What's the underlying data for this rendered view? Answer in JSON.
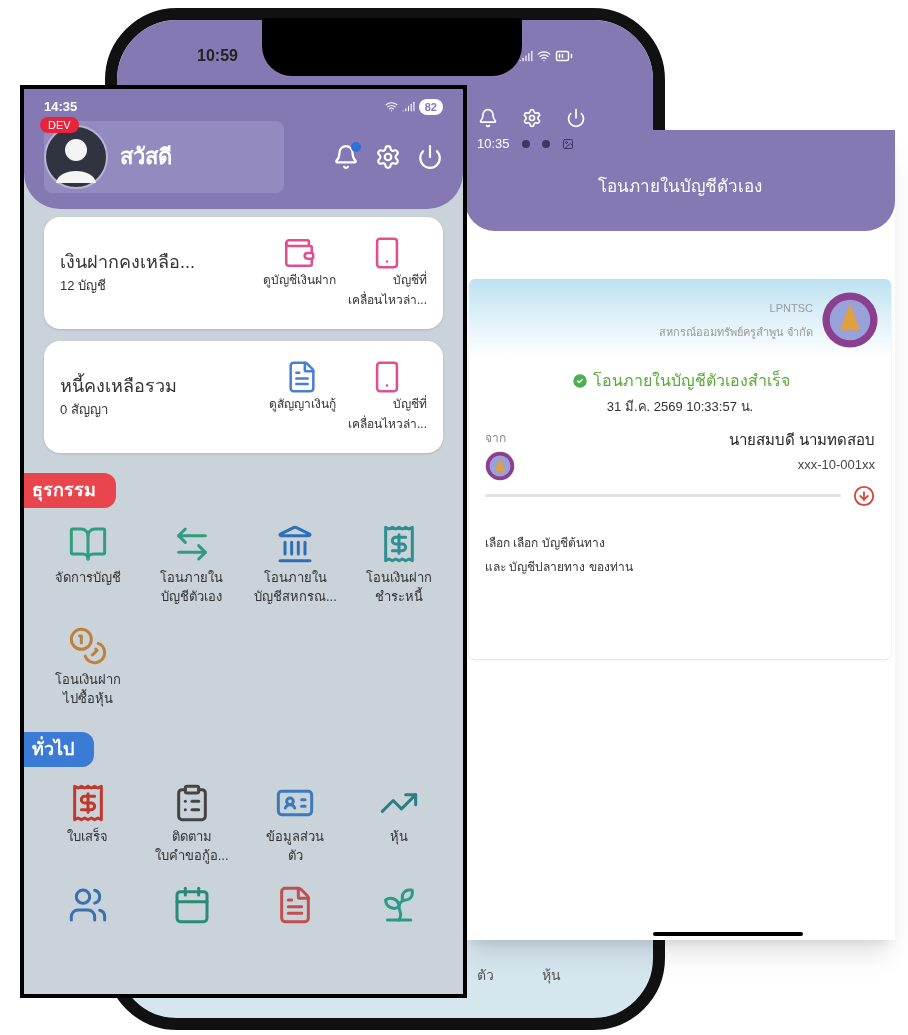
{
  "phone": {
    "time": "10:59",
    "bottom_labels": [
      "ตัว",
      "หุ้น"
    ]
  },
  "home_screen": {
    "status_time": "14:35",
    "battery": "82",
    "badge": "DEV",
    "greeting": "สวัสดี",
    "notification_dot": true,
    "summary_cards": [
      {
        "title": "เงินฝากคงเหลือ...",
        "subtitle": "12 บัญชี",
        "shortcuts": [
          {
            "kind": "wallet",
            "lines": [
              "ดูบัญชีเงินฝาก"
            ]
          },
          {
            "kind": "phone",
            "lines": [
              "บัญชีที่",
              "เคลื่อนไหวล่า..."
            ]
          }
        ]
      },
      {
        "title": "หนี้คงเหลือรวม",
        "subtitle": "0 สัญญา",
        "shortcuts": [
          {
            "kind": "loan",
            "lines": [
              "ดูสัญญาเงินกู้"
            ]
          },
          {
            "kind": "phone",
            "lines": [
              "บัญชีที่",
              "เคลื่อนไหวล่า..."
            ]
          }
        ]
      }
    ],
    "sections": [
      {
        "title": "ธุรกรรม",
        "color": "#e8454d",
        "items": [
          {
            "kind": "book",
            "lines": [
              "จัดการบัญชี"
            ]
          },
          {
            "kind": "swap",
            "lines": [
              "โอนภายใน",
              "บัญชีตัวเอง"
            ]
          },
          {
            "kind": "bank",
            "lines": [
              "โอนภายใน",
              "บัญชีสหกรณ..."
            ]
          },
          {
            "kind": "bill",
            "lines": [
              "โอนเงินฝาก",
              "ชำระหนี้"
            ]
          },
          {
            "kind": "coins",
            "lines": [
              "โอนเงินฝาก",
              "ไปซื้อหุ้น"
            ]
          }
        ]
      },
      {
        "title": "ทั่วไป",
        "color": "#3a7bd5",
        "items": [
          {
            "kind": "receipt",
            "lines": [
              "ใบเสร็จ"
            ]
          },
          {
            "kind": "tracking",
            "lines": [
              "ติดตาม",
              "ใบคำขอกู้อ..."
            ]
          },
          {
            "kind": "profile",
            "lines": [
              "ข้อมูลส่วน",
              "ตัว"
            ]
          },
          {
            "kind": "stock",
            "lines": [
              "หุ้น"
            ]
          },
          {
            "kind": "people"
          },
          {
            "kind": "calendar"
          },
          {
            "kind": "document"
          },
          {
            "kind": "plant"
          }
        ]
      }
    ]
  },
  "transfer_screen": {
    "status_time": "10:35",
    "title": "โอนภายในบัญชีตัวเอง",
    "org_code": "LPNTSC",
    "org_name": "สหกรณ์ออมทรัพย์ครูลำพูน จำกัด",
    "result": "โอนภายในบัญชีตัวเองสำเร็จ",
    "datetime": "31 มี.ค. 2569 10:33:57 น.",
    "from_label": "จาก",
    "account_name": "นายสมบดี นามทดสอบ",
    "account_number": "xxx-10-001xx",
    "hint_lines": [
      "เลือก เลือก บัญชีต้นทาง",
      "และ บัญชีปลายทาง ของท่าน"
    ]
  }
}
